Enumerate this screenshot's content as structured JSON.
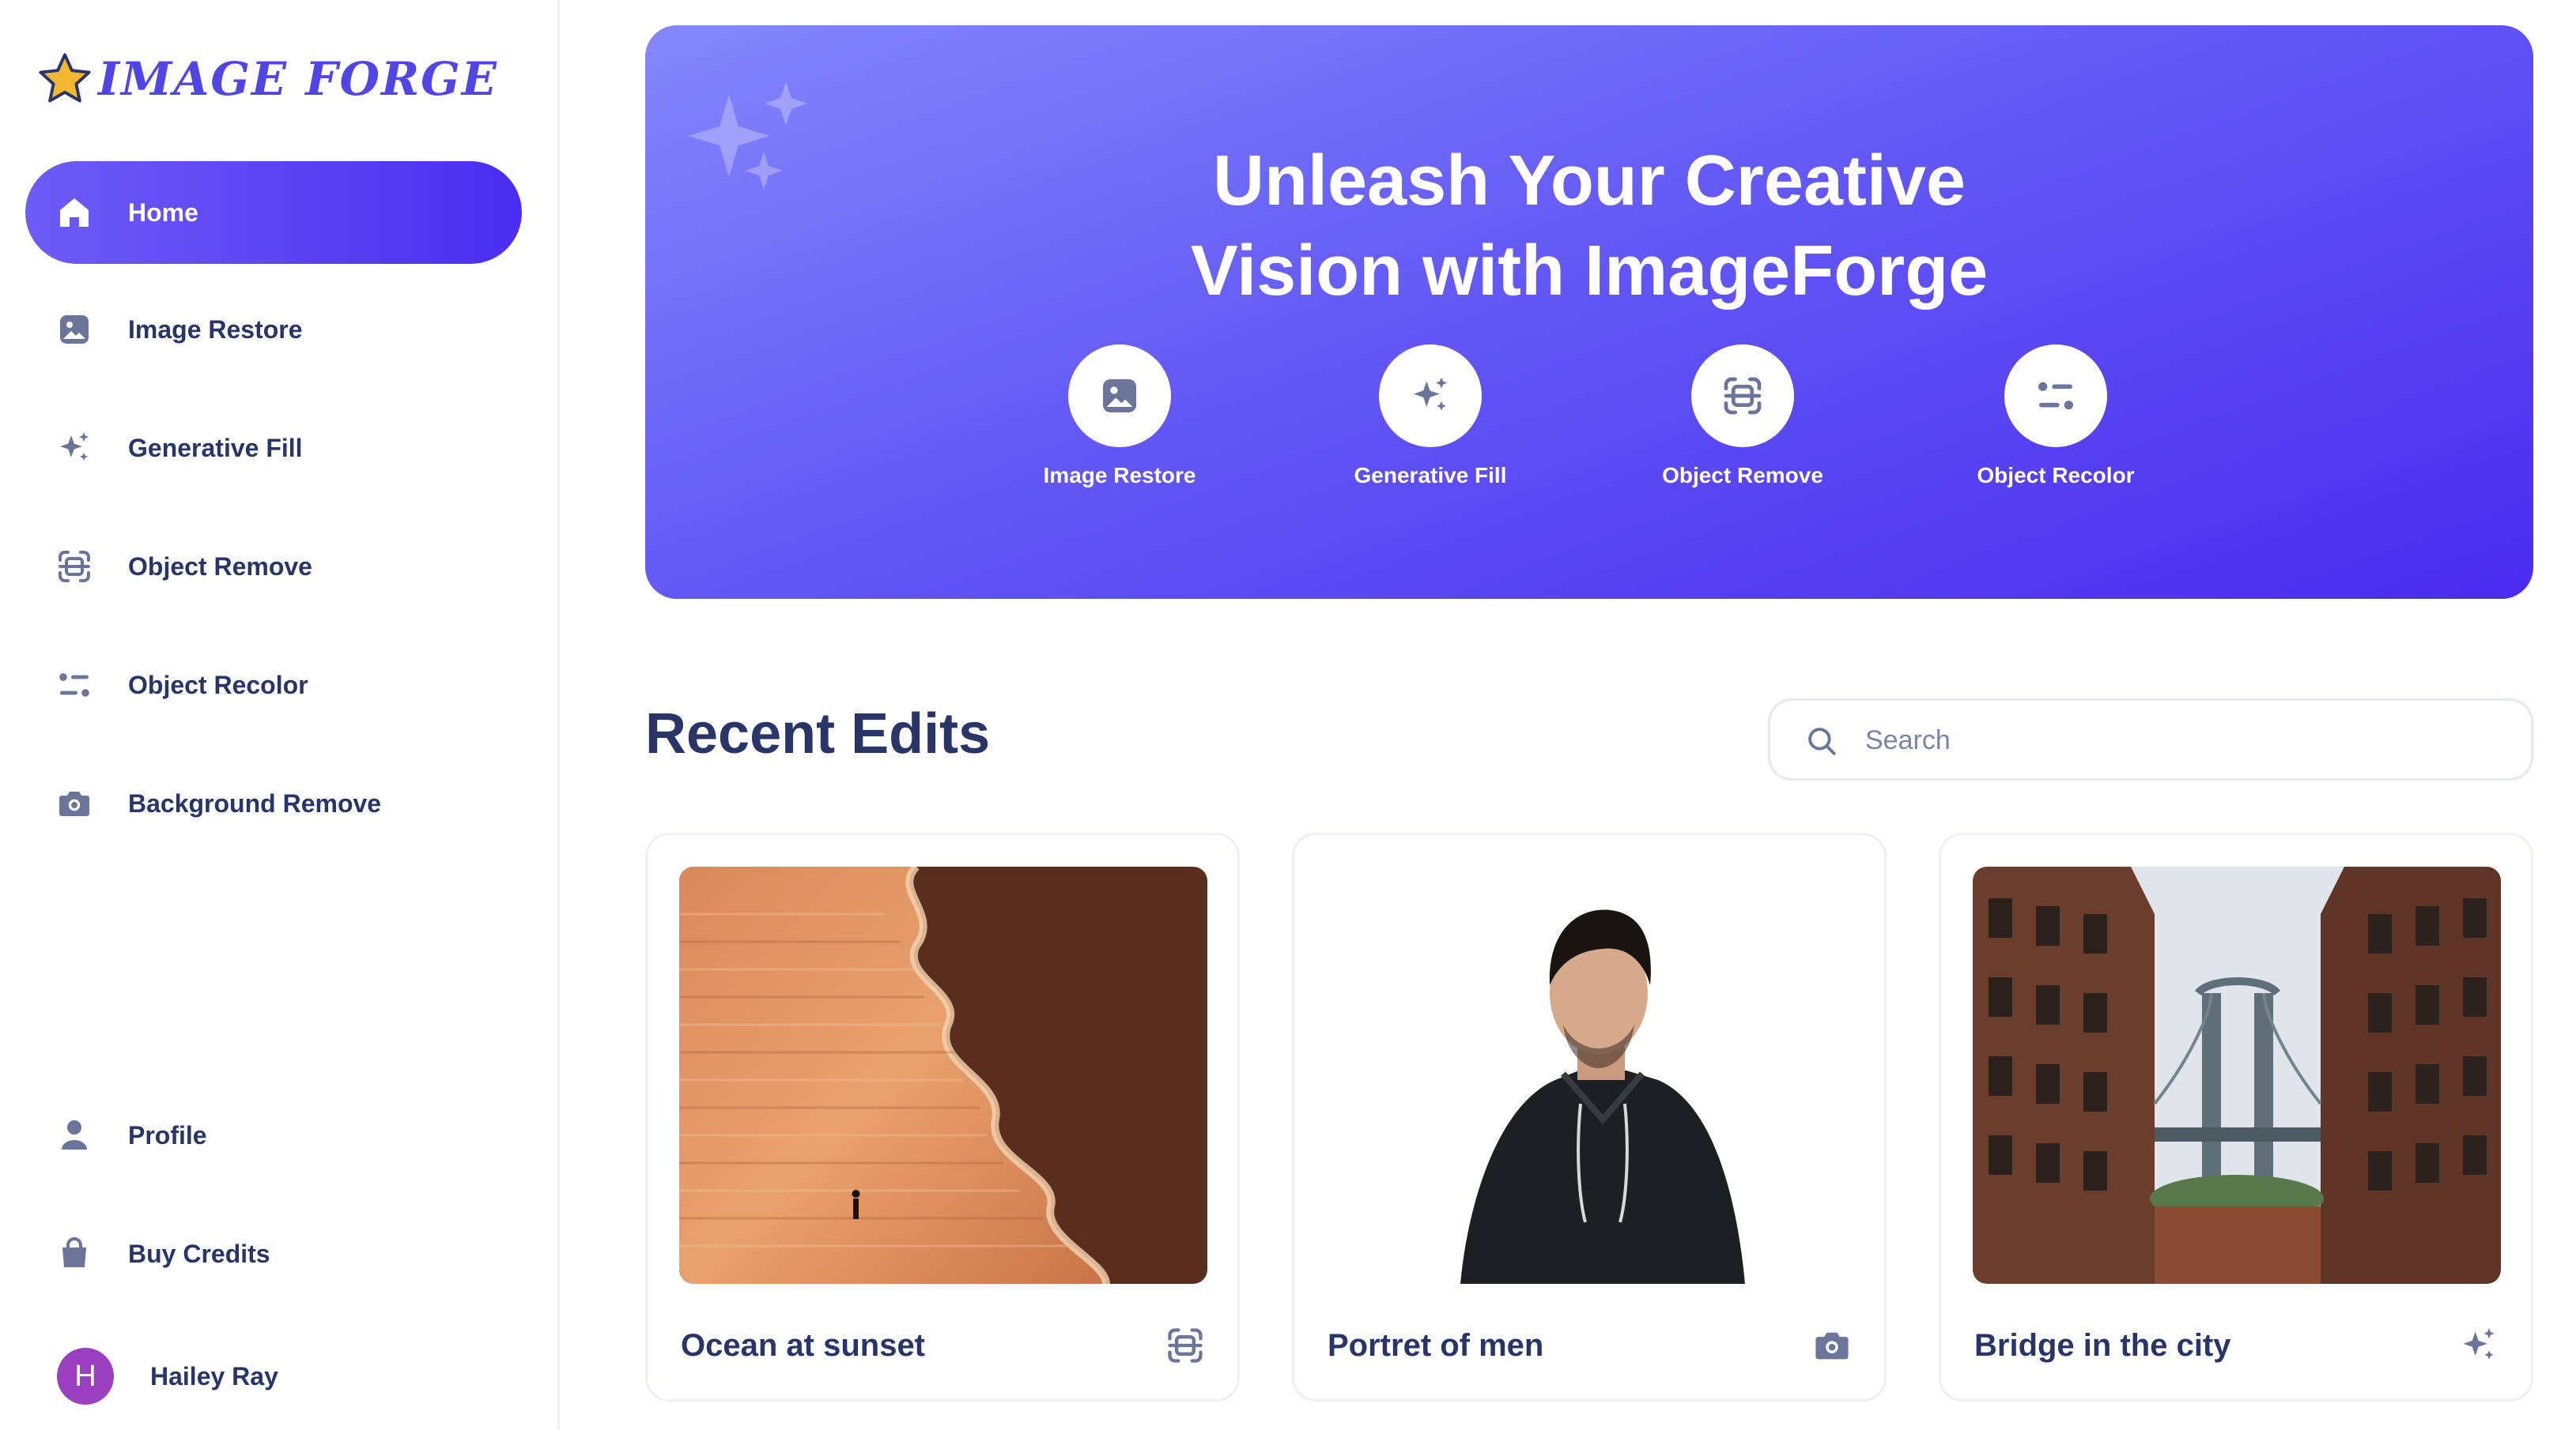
{
  "brand": {
    "name": "IMAGE FORGE",
    "accent": "#4f46e5",
    "star_color": "#f4b731"
  },
  "sidebar": {
    "items": [
      {
        "label": "Home",
        "icon": "home-icon",
        "active": true
      },
      {
        "label": "Image Restore",
        "icon": "image-icon"
      },
      {
        "label": "Generative Fill",
        "icon": "sparkles-icon"
      },
      {
        "label": "Object Remove",
        "icon": "scan-object-icon"
      },
      {
        "label": "Object Recolor",
        "icon": "sliders-icon"
      },
      {
        "label": "Background Remove",
        "icon": "camera-icon"
      }
    ],
    "bottom_items": [
      {
        "label": "Profile",
        "icon": "user-icon"
      },
      {
        "label": "Buy Credits",
        "icon": "shopping-bag-icon"
      }
    ],
    "user": {
      "initial": "H",
      "name": "Hailey Ray",
      "avatar_color": "#9b3fc1"
    }
  },
  "hero": {
    "title_line1": "Unleash Your Creative",
    "title_line2": "Vision with ImageForge",
    "tools": [
      {
        "label": "Image Restore",
        "icon": "image-icon"
      },
      {
        "label": "Generative Fill",
        "icon": "sparkles-icon"
      },
      {
        "label": "Object Remove",
        "icon": "scan-object-icon"
      },
      {
        "label": "Object Recolor",
        "icon": "sliders-icon"
      }
    ]
  },
  "recent": {
    "title": "Recent Edits",
    "search_placeholder": "Search",
    "cards": [
      {
        "title": "Ocean at sunset",
        "icon": "scan-object-icon"
      },
      {
        "title": "Portret of men",
        "icon": "camera-icon"
      },
      {
        "title": "Bridge in the city",
        "icon": "sparkles-icon"
      }
    ]
  }
}
